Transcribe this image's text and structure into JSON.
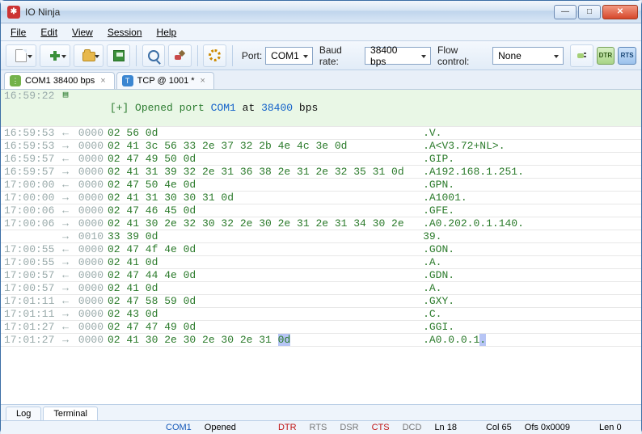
{
  "window": {
    "title": "IO Ninja"
  },
  "menu": {
    "file": "File",
    "edit": "Edit",
    "view": "View",
    "session": "Session",
    "help": "Help"
  },
  "toolbar": {
    "port_label": "Port:",
    "port_value": "COM1",
    "baud_label": "Baud rate:",
    "baud_value": "38400 bps",
    "flow_label": "Flow control:",
    "flow_value": "None",
    "dtr": "DTR",
    "rts": "RTS"
  },
  "tabs": {
    "a": {
      "label": "COM1 38400 bps"
    },
    "b": {
      "label": "TCP @ 1001 *"
    }
  },
  "log_header": {
    "ts": "16:59:22",
    "text_prefix": "[+] Opened port ",
    "port": "COM1",
    "text_mid": " at ",
    "rate": "38400",
    "text_suffix": " bps"
  },
  "rows": [
    {
      "ts": "16:59:53",
      "dir": "rx",
      "off": "0000",
      "hex": "02 56 0d",
      "ascii": ".V."
    },
    {
      "ts": "16:59:53",
      "dir": "tx",
      "off": "0000",
      "hex": "02 41 3c 56 33 2e 37 32 2b 4e 4c 3e 0d",
      "ascii": ".A<V3.72+NL>."
    },
    {
      "ts": "16:59:57",
      "dir": "rx",
      "off": "0000",
      "hex": "02 47 49 50 0d",
      "ascii": ".GIP."
    },
    {
      "ts": "16:59:57",
      "dir": "tx",
      "off": "0000",
      "hex": "02 41 31 39 32 2e 31 36 38 2e 31 2e 32 35 31 0d",
      "ascii": ".A192.168.1.251."
    },
    {
      "ts": "17:00:00",
      "dir": "rx",
      "off": "0000",
      "hex": "02 47 50 4e 0d",
      "ascii": ".GPN."
    },
    {
      "ts": "17:00:00",
      "dir": "tx",
      "off": "0000",
      "hex": "02 41 31 30 30 31 0d",
      "ascii": ".A1001."
    },
    {
      "ts": "17:00:06",
      "dir": "rx",
      "off": "0000",
      "hex": "02 47 46 45 0d",
      "ascii": ".GFE."
    },
    {
      "ts": "17:00:06",
      "dir": "tx",
      "off": "0000",
      "hex": "02 41 30 2e 32 30 32 2e 30 2e 31 2e 31 34 30 2e",
      "ascii": ".A0.202.0.1.140."
    },
    {
      "ts": "",
      "dir": "tx",
      "off": "0010",
      "hex": "33 39 0d",
      "ascii": "39."
    },
    {
      "ts": "17:00:55",
      "dir": "rx",
      "off": "0000",
      "hex": "02 47 4f 4e 0d",
      "ascii": ".GON."
    },
    {
      "ts": "17:00:55",
      "dir": "tx",
      "off": "0000",
      "hex": "02 41 0d",
      "ascii": ".A."
    },
    {
      "ts": "17:00:57",
      "dir": "rx",
      "off": "0000",
      "hex": "02 47 44 4e 0d",
      "ascii": ".GDN."
    },
    {
      "ts": "17:00:57",
      "dir": "tx",
      "off": "0000",
      "hex": "02 41 0d",
      "ascii": ".A."
    },
    {
      "ts": "17:01:11",
      "dir": "rx",
      "off": "0000",
      "hex": "02 47 58 59 0d",
      "ascii": ".GXY."
    },
    {
      "ts": "17:01:11",
      "dir": "tx",
      "off": "0000",
      "hex": "02 43 0d",
      "ascii": ".C."
    },
    {
      "ts": "17:01:27",
      "dir": "rx",
      "off": "0000",
      "hex": "02 47 47 49 0d",
      "ascii": ".GGI."
    },
    {
      "ts": "17:01:27",
      "dir": "tx",
      "off": "0000",
      "hex": "02 41 30 2e 30 2e 30 2e 31 ",
      "hex_hl": "0d",
      "ascii": ".A0.0.0.1",
      "ascii_hl": "."
    }
  ],
  "bottom_tabs": {
    "log": "Log",
    "terminal": "Terminal"
  },
  "status": {
    "port": "COM1",
    "state": "Opened",
    "dtr": "DTR",
    "rts": "RTS",
    "dsr": "DSR",
    "cts": "CTS",
    "dcd": "DCD",
    "ln": "Ln 18",
    "col": "Col 65",
    "ofs": "Ofs 0x0009",
    "len": "Len 0"
  }
}
